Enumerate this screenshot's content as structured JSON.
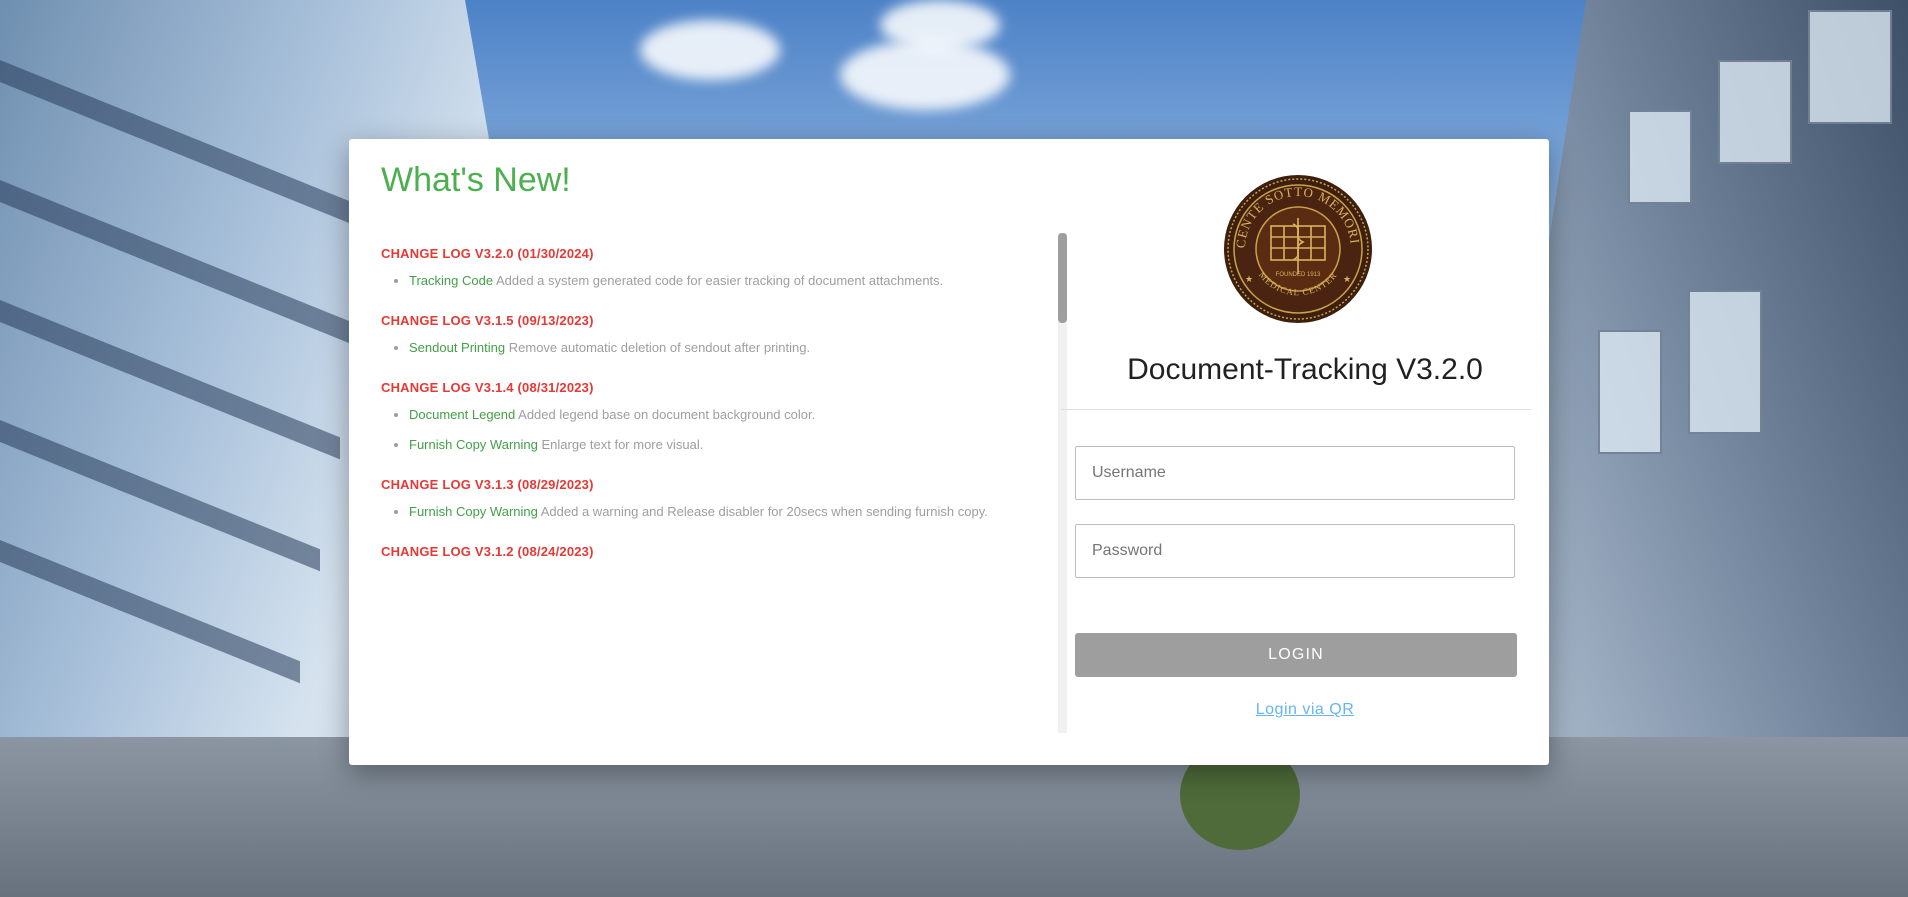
{
  "whats_new": {
    "title": "What's New!",
    "releases": [
      {
        "title": "CHANGE LOG V3.2.0 (01/30/2024)",
        "items": [
          {
            "feature": "Tracking Code",
            "description": "Added a system generated code for easier tracking of document attachments."
          }
        ]
      },
      {
        "title": "CHANGE LOG V3.1.5 (09/13/2023)",
        "items": [
          {
            "feature": "Sendout Printing",
            "description": "Remove automatic deletion of sendout after printing."
          }
        ]
      },
      {
        "title": "CHANGE LOG V3.1.4 (08/31/2023)",
        "items": [
          {
            "feature": "Document Legend",
            "description": "Added legend base on document background color."
          },
          {
            "feature": "Furnish Copy Warning",
            "description": "Enlarge text for more visual."
          }
        ]
      },
      {
        "title": "CHANGE LOG V3.1.3 (08/29/2023)",
        "items": [
          {
            "feature": "Furnish Copy Warning",
            "description": "Added a warning and Release disabler for 20secs when sending furnish copy."
          }
        ]
      },
      {
        "title": "CHANGE LOG V3.1.2 (08/24/2023)",
        "items": []
      }
    ]
  },
  "seal": {
    "top_text": "VICENTE SOTTO MEMORIAL",
    "bottom_text": "MEDICAL CENTER",
    "founded": "FOUNDED 1913"
  },
  "login": {
    "app_title": "Document-Tracking V3.2.0",
    "username_placeholder": "Username",
    "password_placeholder": "Password",
    "login_label": "LOGIN",
    "qr_label": "Login via QR"
  },
  "colors": {
    "accent_green": "#4caf50",
    "changelog_red": "#e53935",
    "link_blue": "#64b5f6",
    "button_grey": "#9e9e9e"
  }
}
